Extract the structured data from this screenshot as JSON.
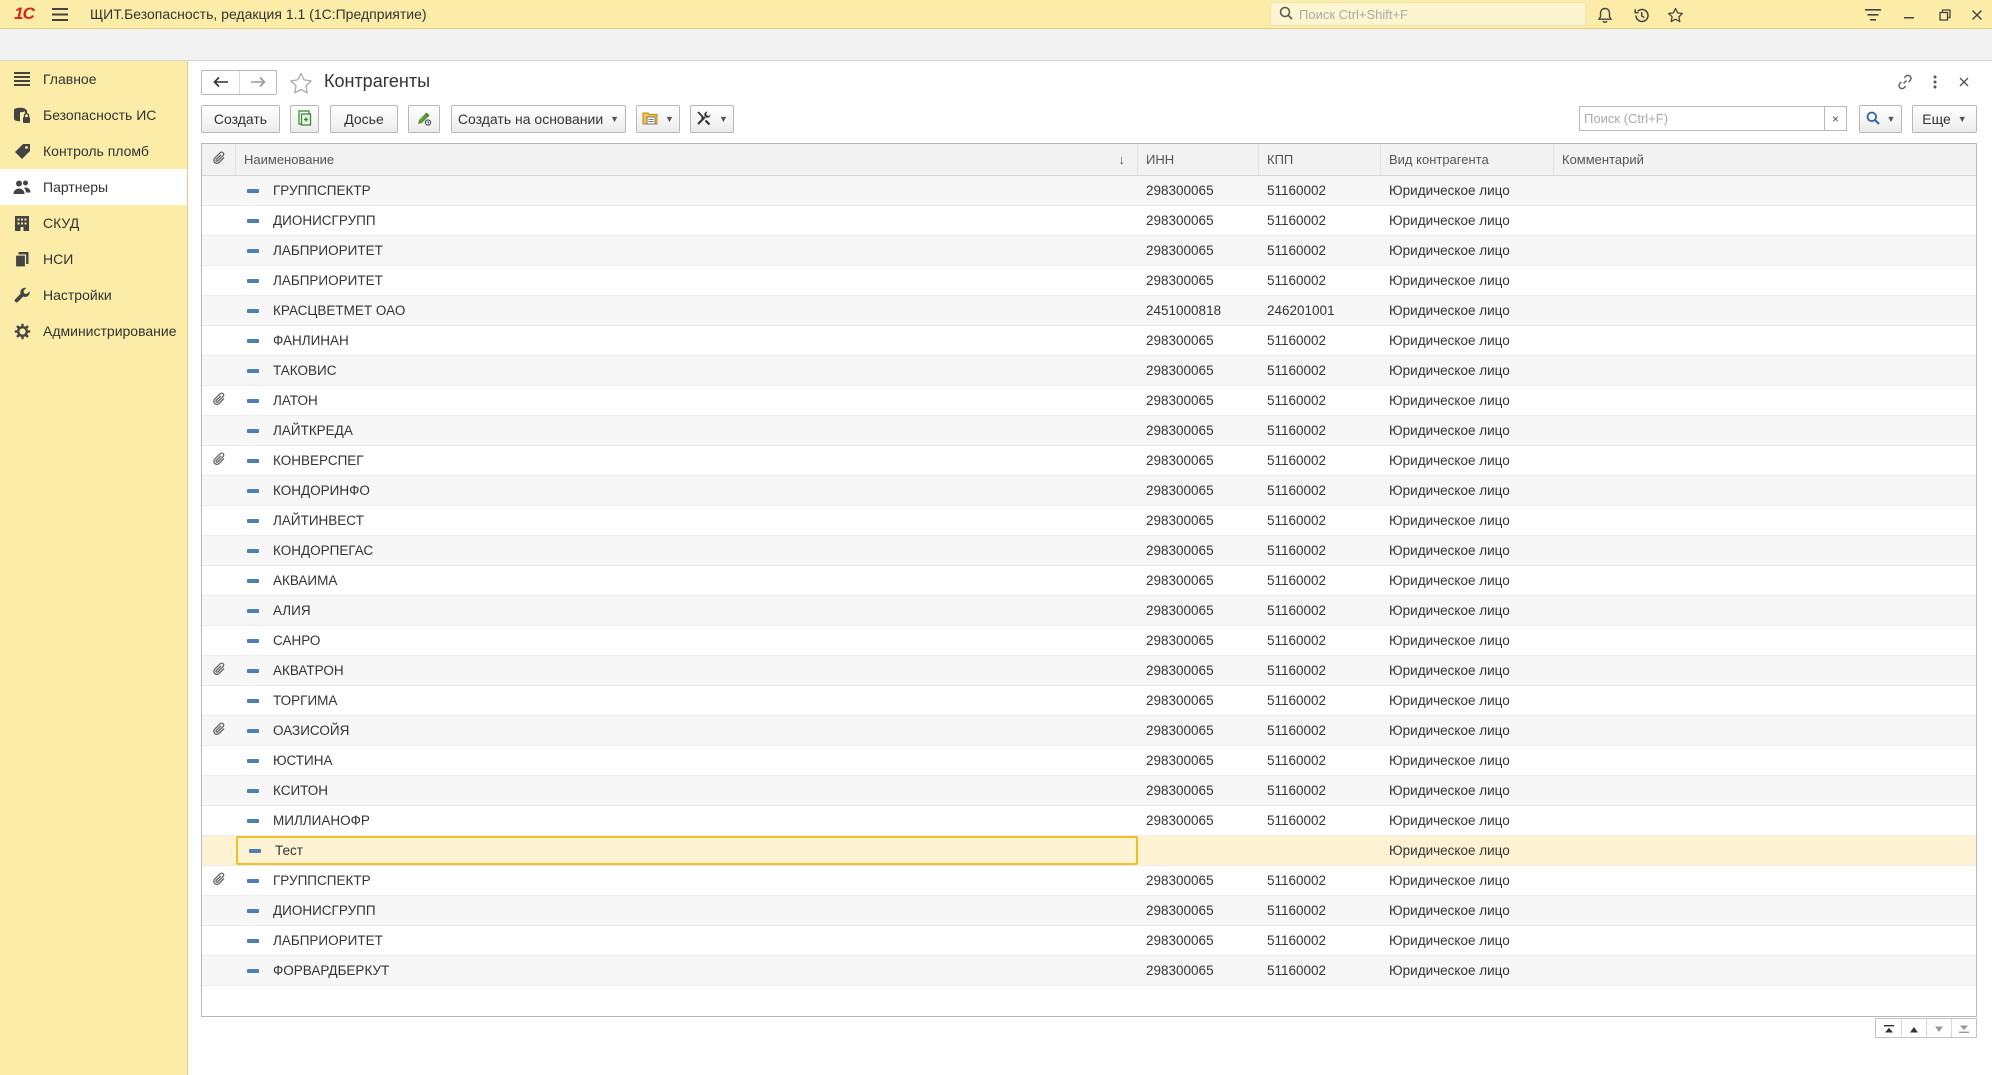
{
  "app": {
    "logo_text": "1С",
    "title": "ЩИТ.Безопасность, редакция 1.1  (1С:Предприятие)",
    "search_placeholder": "Поиск Ctrl+Shift+F"
  },
  "sidebar": {
    "items": [
      {
        "label": "Главное",
        "icon": "menu-lines-icon",
        "active": false
      },
      {
        "label": "Безопасность ИС",
        "icon": "database-lock-icon",
        "active": false
      },
      {
        "label": "Контроль пломб",
        "icon": "tag-icon",
        "active": false
      },
      {
        "label": "Партнеры",
        "icon": "people-icon",
        "active": true
      },
      {
        "label": "СКУД",
        "icon": "building-icon",
        "active": false
      },
      {
        "label": "НСИ",
        "icon": "documents-icon",
        "active": false
      },
      {
        "label": "Настройки",
        "icon": "wrench-icon",
        "active": false
      },
      {
        "label": "Администрирование",
        "icon": "gear-icon",
        "active": false
      }
    ]
  },
  "page": {
    "title": "Контрагенты"
  },
  "toolbar": {
    "create_label": "Создать",
    "dossier_label": "Досье",
    "create_based_label": "Создать на основании",
    "search_placeholder": "Поиск (Ctrl+F)",
    "search_clear": "×",
    "more_label": "Еще"
  },
  "table": {
    "columns": {
      "name": "Наименование",
      "inn": "ИНН",
      "kpp": "КПП",
      "kind": "Вид контрагента",
      "comment": "Комментарий"
    },
    "rows": [
      {
        "att": false,
        "name": "ГРУППСПЕКТР",
        "inn": "298300065",
        "kpp": "51160002",
        "kind": "Юридическое лицо",
        "comment": ""
      },
      {
        "att": false,
        "name": "ДИОНИСГРУПП",
        "inn": "298300065",
        "kpp": "51160002",
        "kind": "Юридическое лицо",
        "comment": ""
      },
      {
        "att": false,
        "name": "ЛАБПРИОРИТЕТ",
        "inn": "298300065",
        "kpp": "51160002",
        "kind": "Юридическое лицо",
        "comment": ""
      },
      {
        "att": false,
        "name": "ЛАБПРИОРИТЕТ",
        "inn": "298300065",
        "kpp": "51160002",
        "kind": "Юридическое лицо",
        "comment": ""
      },
      {
        "att": false,
        "name": "КРАСЦВЕТМЕТ ОАО",
        "inn": "2451000818",
        "kpp": "246201001",
        "kind": "Юридическое лицо",
        "comment": ""
      },
      {
        "att": false,
        "name": "ФАНЛИНАН",
        "inn": "298300065",
        "kpp": "51160002",
        "kind": "Юридическое лицо",
        "comment": ""
      },
      {
        "att": false,
        "name": "ТАКОВИС",
        "inn": "298300065",
        "kpp": "51160002",
        "kind": "Юридическое лицо",
        "comment": ""
      },
      {
        "att": true,
        "name": "ЛАТОН",
        "inn": "298300065",
        "kpp": "51160002",
        "kind": "Юридическое лицо",
        "comment": ""
      },
      {
        "att": false,
        "name": "ЛАЙТКРЕДА",
        "inn": "298300065",
        "kpp": "51160002",
        "kind": "Юридическое лицо",
        "comment": ""
      },
      {
        "att": true,
        "name": "КОНВЕРСПЕГ",
        "inn": "298300065",
        "kpp": "51160002",
        "kind": "Юридическое лицо",
        "comment": ""
      },
      {
        "att": false,
        "name": "КОНДОРИНФО",
        "inn": "298300065",
        "kpp": "51160002",
        "kind": "Юридическое лицо",
        "comment": ""
      },
      {
        "att": false,
        "name": "ЛАЙТИНВЕСТ",
        "inn": "298300065",
        "kpp": "51160002",
        "kind": "Юридическое лицо",
        "comment": ""
      },
      {
        "att": false,
        "name": "КОНДОРПЕГАС",
        "inn": "298300065",
        "kpp": "51160002",
        "kind": "Юридическое лицо",
        "comment": ""
      },
      {
        "att": false,
        "name": "АКВАИМА",
        "inn": "298300065",
        "kpp": "51160002",
        "kind": "Юридическое лицо",
        "comment": ""
      },
      {
        "att": false,
        "name": "АЛИЯ",
        "inn": "298300065",
        "kpp": "51160002",
        "kind": "Юридическое лицо",
        "comment": ""
      },
      {
        "att": false,
        "name": "САНРО",
        "inn": "298300065",
        "kpp": "51160002",
        "kind": "Юридическое лицо",
        "comment": ""
      },
      {
        "att": true,
        "name": "АКВАТРОН",
        "inn": "298300065",
        "kpp": "51160002",
        "kind": "Юридическое лицо",
        "comment": ""
      },
      {
        "att": false,
        "name": "ТОРГИМА",
        "inn": "298300065",
        "kpp": "51160002",
        "kind": "Юридическое лицо",
        "comment": ""
      },
      {
        "att": true,
        "name": "ОАЗИСОЙЯ",
        "inn": "298300065",
        "kpp": "51160002",
        "kind": "Юридическое лицо",
        "comment": ""
      },
      {
        "att": false,
        "name": "ЮСТИНА",
        "inn": "298300065",
        "kpp": "51160002",
        "kind": "Юридическое лицо",
        "comment": ""
      },
      {
        "att": false,
        "name": "КСИТОН",
        "inn": "298300065",
        "kpp": "51160002",
        "kind": "Юридическое лицо",
        "comment": ""
      },
      {
        "att": false,
        "name": "МИЛЛИАНОФР",
        "inn": "298300065",
        "kpp": "51160002",
        "kind": "Юридическое лицо",
        "comment": ""
      },
      {
        "att": false,
        "name": "Тест",
        "inn": "",
        "kpp": "",
        "kind": "Юридическое лицо",
        "comment": "",
        "selected": true
      },
      {
        "att": true,
        "name": "ГРУППСПЕКТР",
        "inn": "298300065",
        "kpp": "51160002",
        "kind": "Юридическое лицо",
        "comment": ""
      },
      {
        "att": false,
        "name": "ДИОНИСГРУПП",
        "inn": "298300065",
        "kpp": "51160002",
        "kind": "Юридическое лицо",
        "comment": ""
      },
      {
        "att": false,
        "name": "ЛАБПРИОРИТЕТ",
        "inn": "298300065",
        "kpp": "51160002",
        "kind": "Юридическое лицо",
        "comment": ""
      },
      {
        "att": false,
        "name": "ФОРВАРДБЕРКУТ",
        "inn": "298300065",
        "kpp": "51160002",
        "kind": "Юридическое лицо",
        "comment": ""
      }
    ]
  },
  "colors": {
    "panel_yellow": "#fbeca7",
    "selection_border": "#f0c028",
    "selection_fill": "#fdf3d3",
    "row_icon": "#4f7eb0",
    "logo_red": "#d6261c"
  }
}
